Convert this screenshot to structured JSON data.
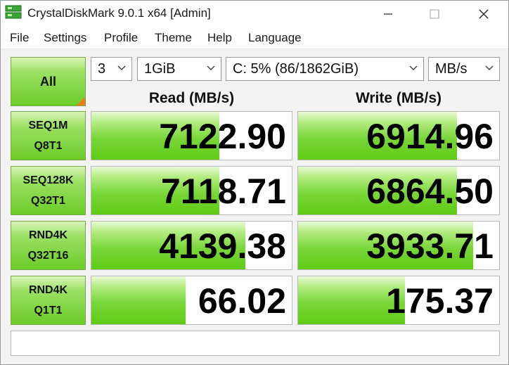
{
  "window": {
    "title": "CrystalDiskMark 9.0.1 x64 [Admin]"
  },
  "menu": [
    "File",
    "Settings",
    "Profile",
    "Theme",
    "Help",
    "Language"
  ],
  "controls": {
    "all_label": "All",
    "count": "3",
    "size": "1GiB",
    "drive": "C: 5% (86/1862GiB)",
    "unit": "MB/s"
  },
  "headers": {
    "read": "Read (MB/s)",
    "write": "Write (MB/s)"
  },
  "rows": [
    {
      "line1": "SEQ1M",
      "line2": "Q8T1",
      "read": "7122.90",
      "write": "6914.96",
      "read_fill": 0.64,
      "write_fill": 0.79
    },
    {
      "line1": "SEQ128K",
      "line2": "Q32T1",
      "read": "7118.71",
      "write": "6864.50",
      "read_fill": 0.64,
      "write_fill": 0.79
    },
    {
      "line1": "RND4K",
      "line2": "Q32T16",
      "read": "4139.38",
      "write": "3933.71",
      "read_fill": 0.77,
      "write_fill": 0.87
    },
    {
      "line1": "RND4K",
      "line2": "Q1T1",
      "read": "66.02",
      "write": "175.37",
      "read_fill": 0.47,
      "write_fill": 0.53
    }
  ],
  "status_text": "",
  "colors": {
    "bar_green": "#5fcb14",
    "label_green": "#6ccc28",
    "corner_orange": "#f07d1a"
  }
}
